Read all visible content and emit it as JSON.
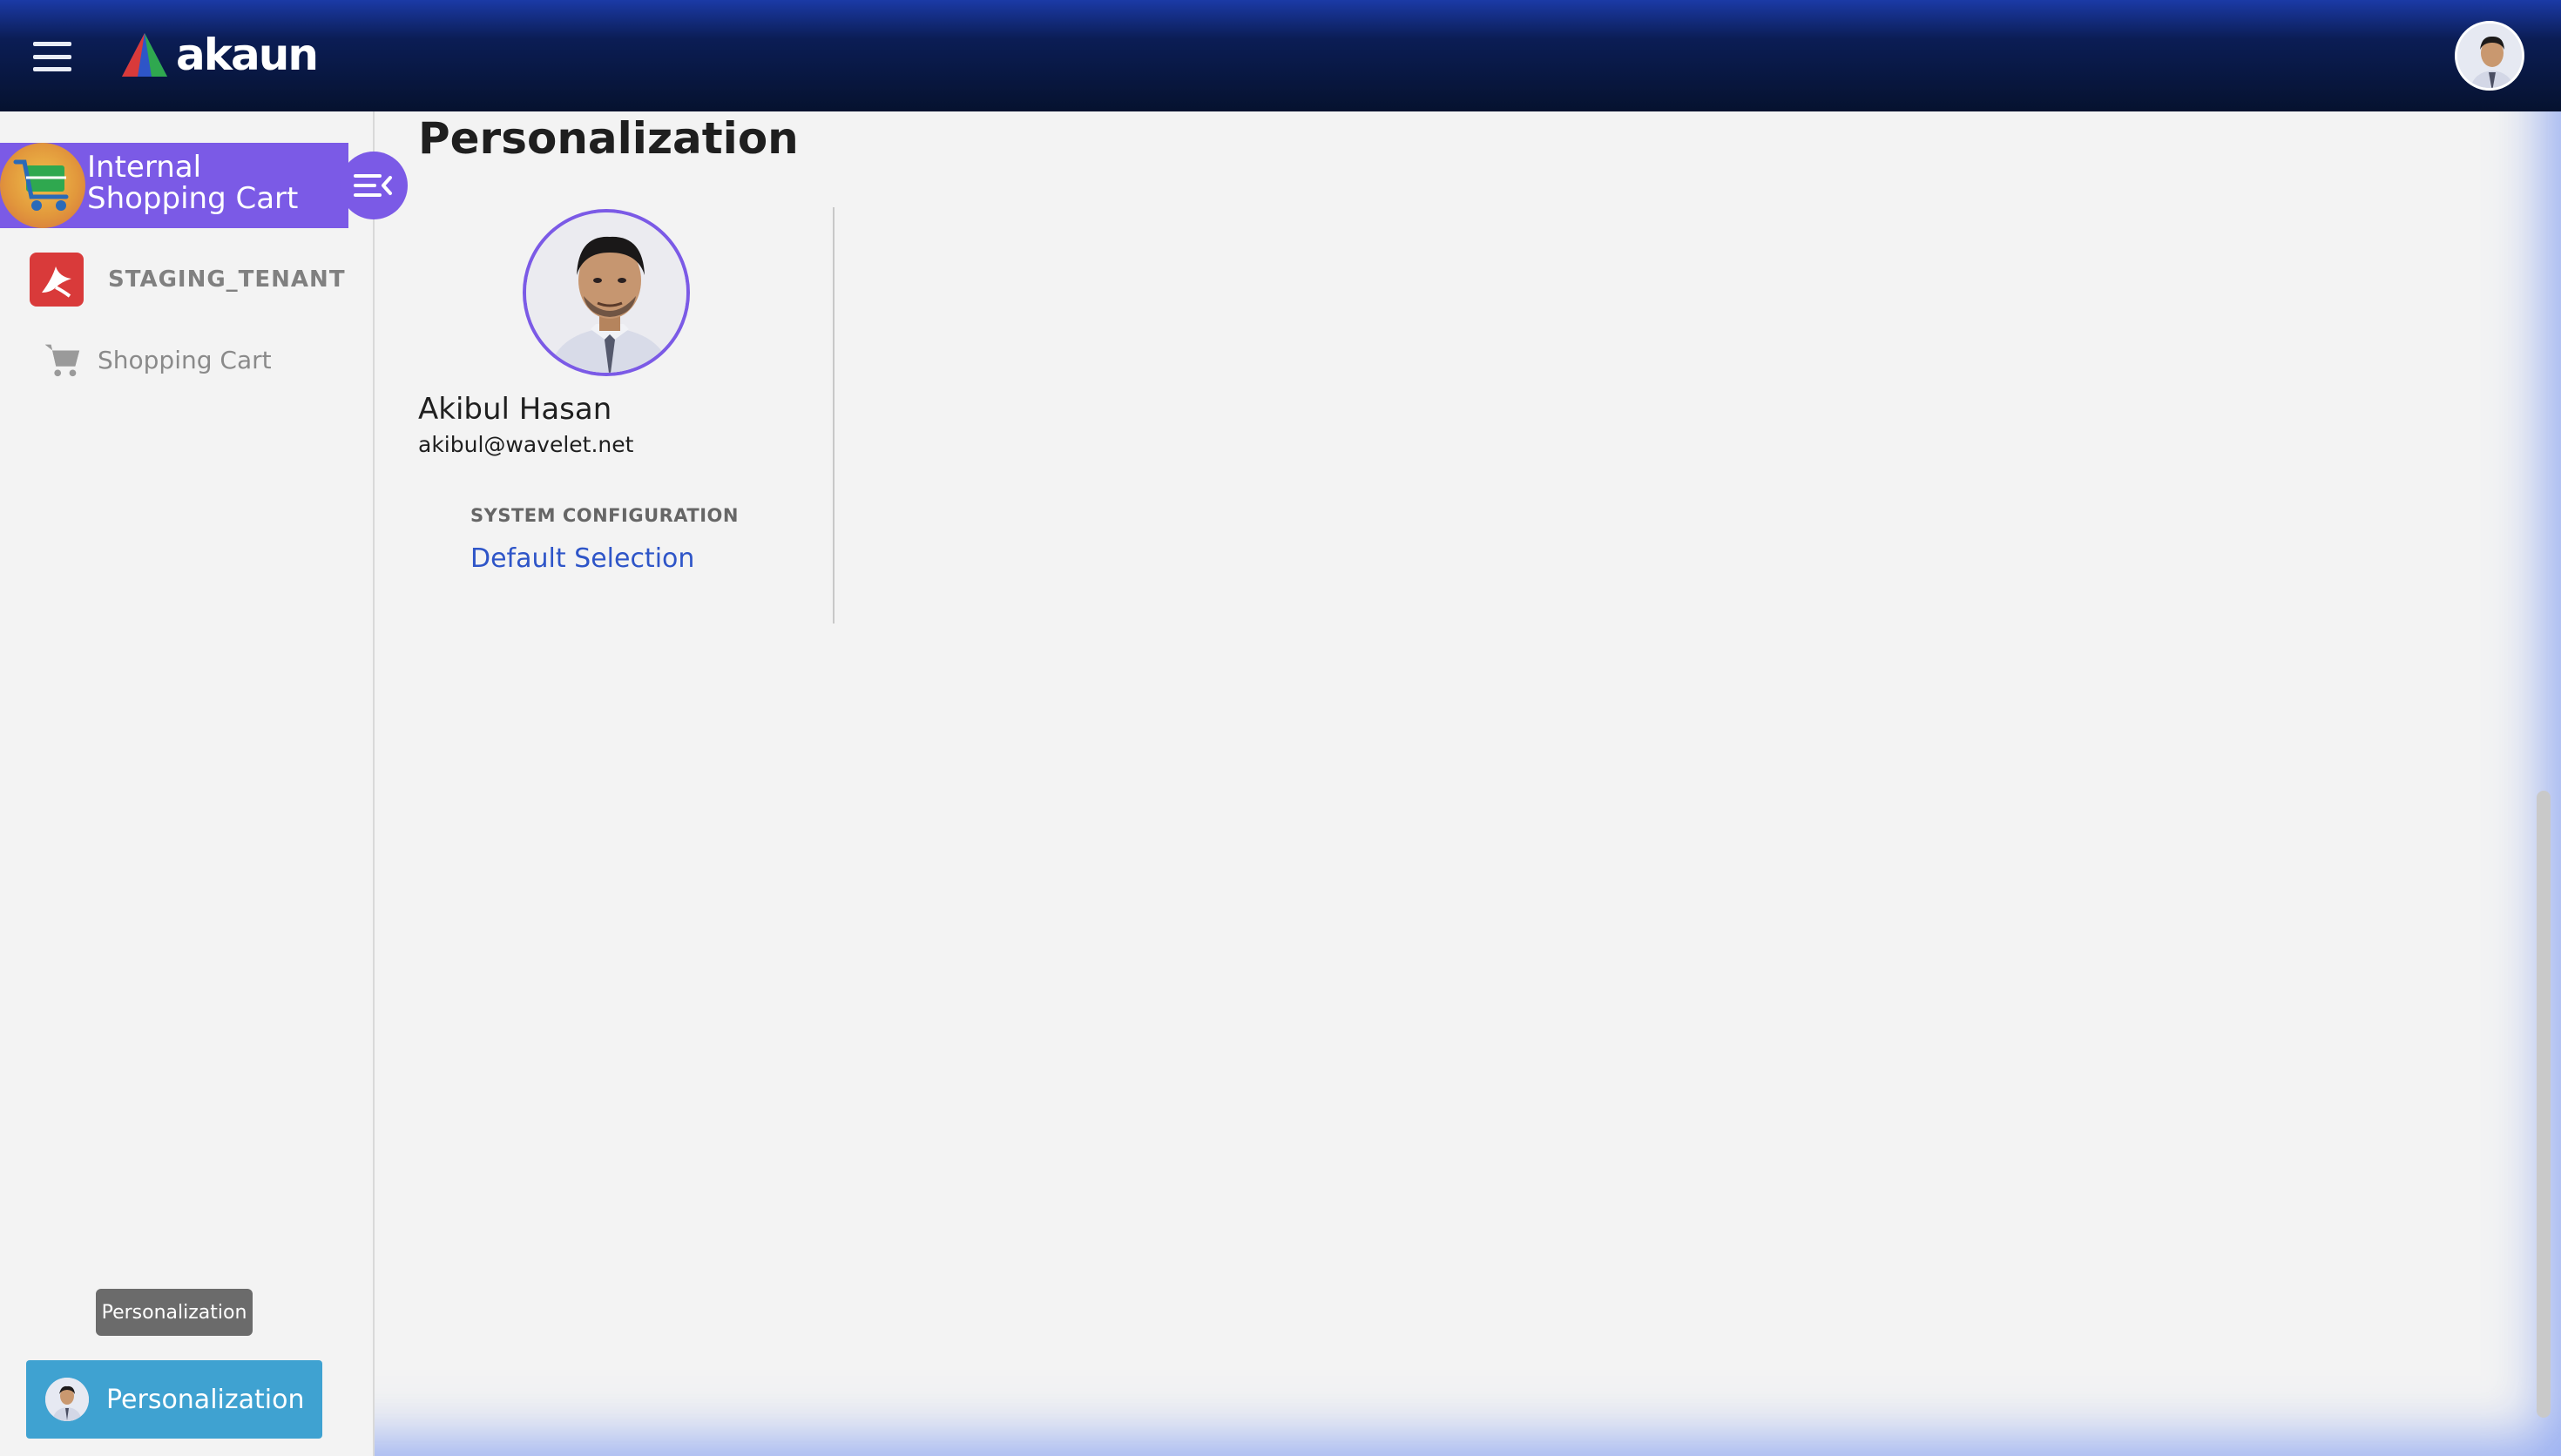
{
  "app": {
    "brand": "akaun",
    "brand_colors": {
      "red": "#d93a3a",
      "green": "#2fa84f",
      "blue": "#2e55c8"
    },
    "accent": "#7b5ae6",
    "top_avatar_icon": "user-avatar"
  },
  "sidebar": {
    "app_title": "Internal Shopping Cart",
    "app_icon": "shopping-cart-icon",
    "collapse_icon": "collapse-menu-icon",
    "tenant": {
      "label": "STAGING_TENANT",
      "icon": "tenant-logo-icon"
    },
    "items": [
      {
        "label": "Shopping Cart",
        "icon": "shopping-cart-icon"
      }
    ],
    "tooltip": "Personalization",
    "personalization_button": {
      "label": "Personalization",
      "icon": "user-avatar"
    }
  },
  "main": {
    "title": "Personalization",
    "profile": {
      "name": "Akibul Hasan",
      "email": "akibul@wavelet.net"
    },
    "system_configuration": {
      "label": "SYSTEM CONFIGURATION",
      "link": "Default Selection"
    }
  }
}
